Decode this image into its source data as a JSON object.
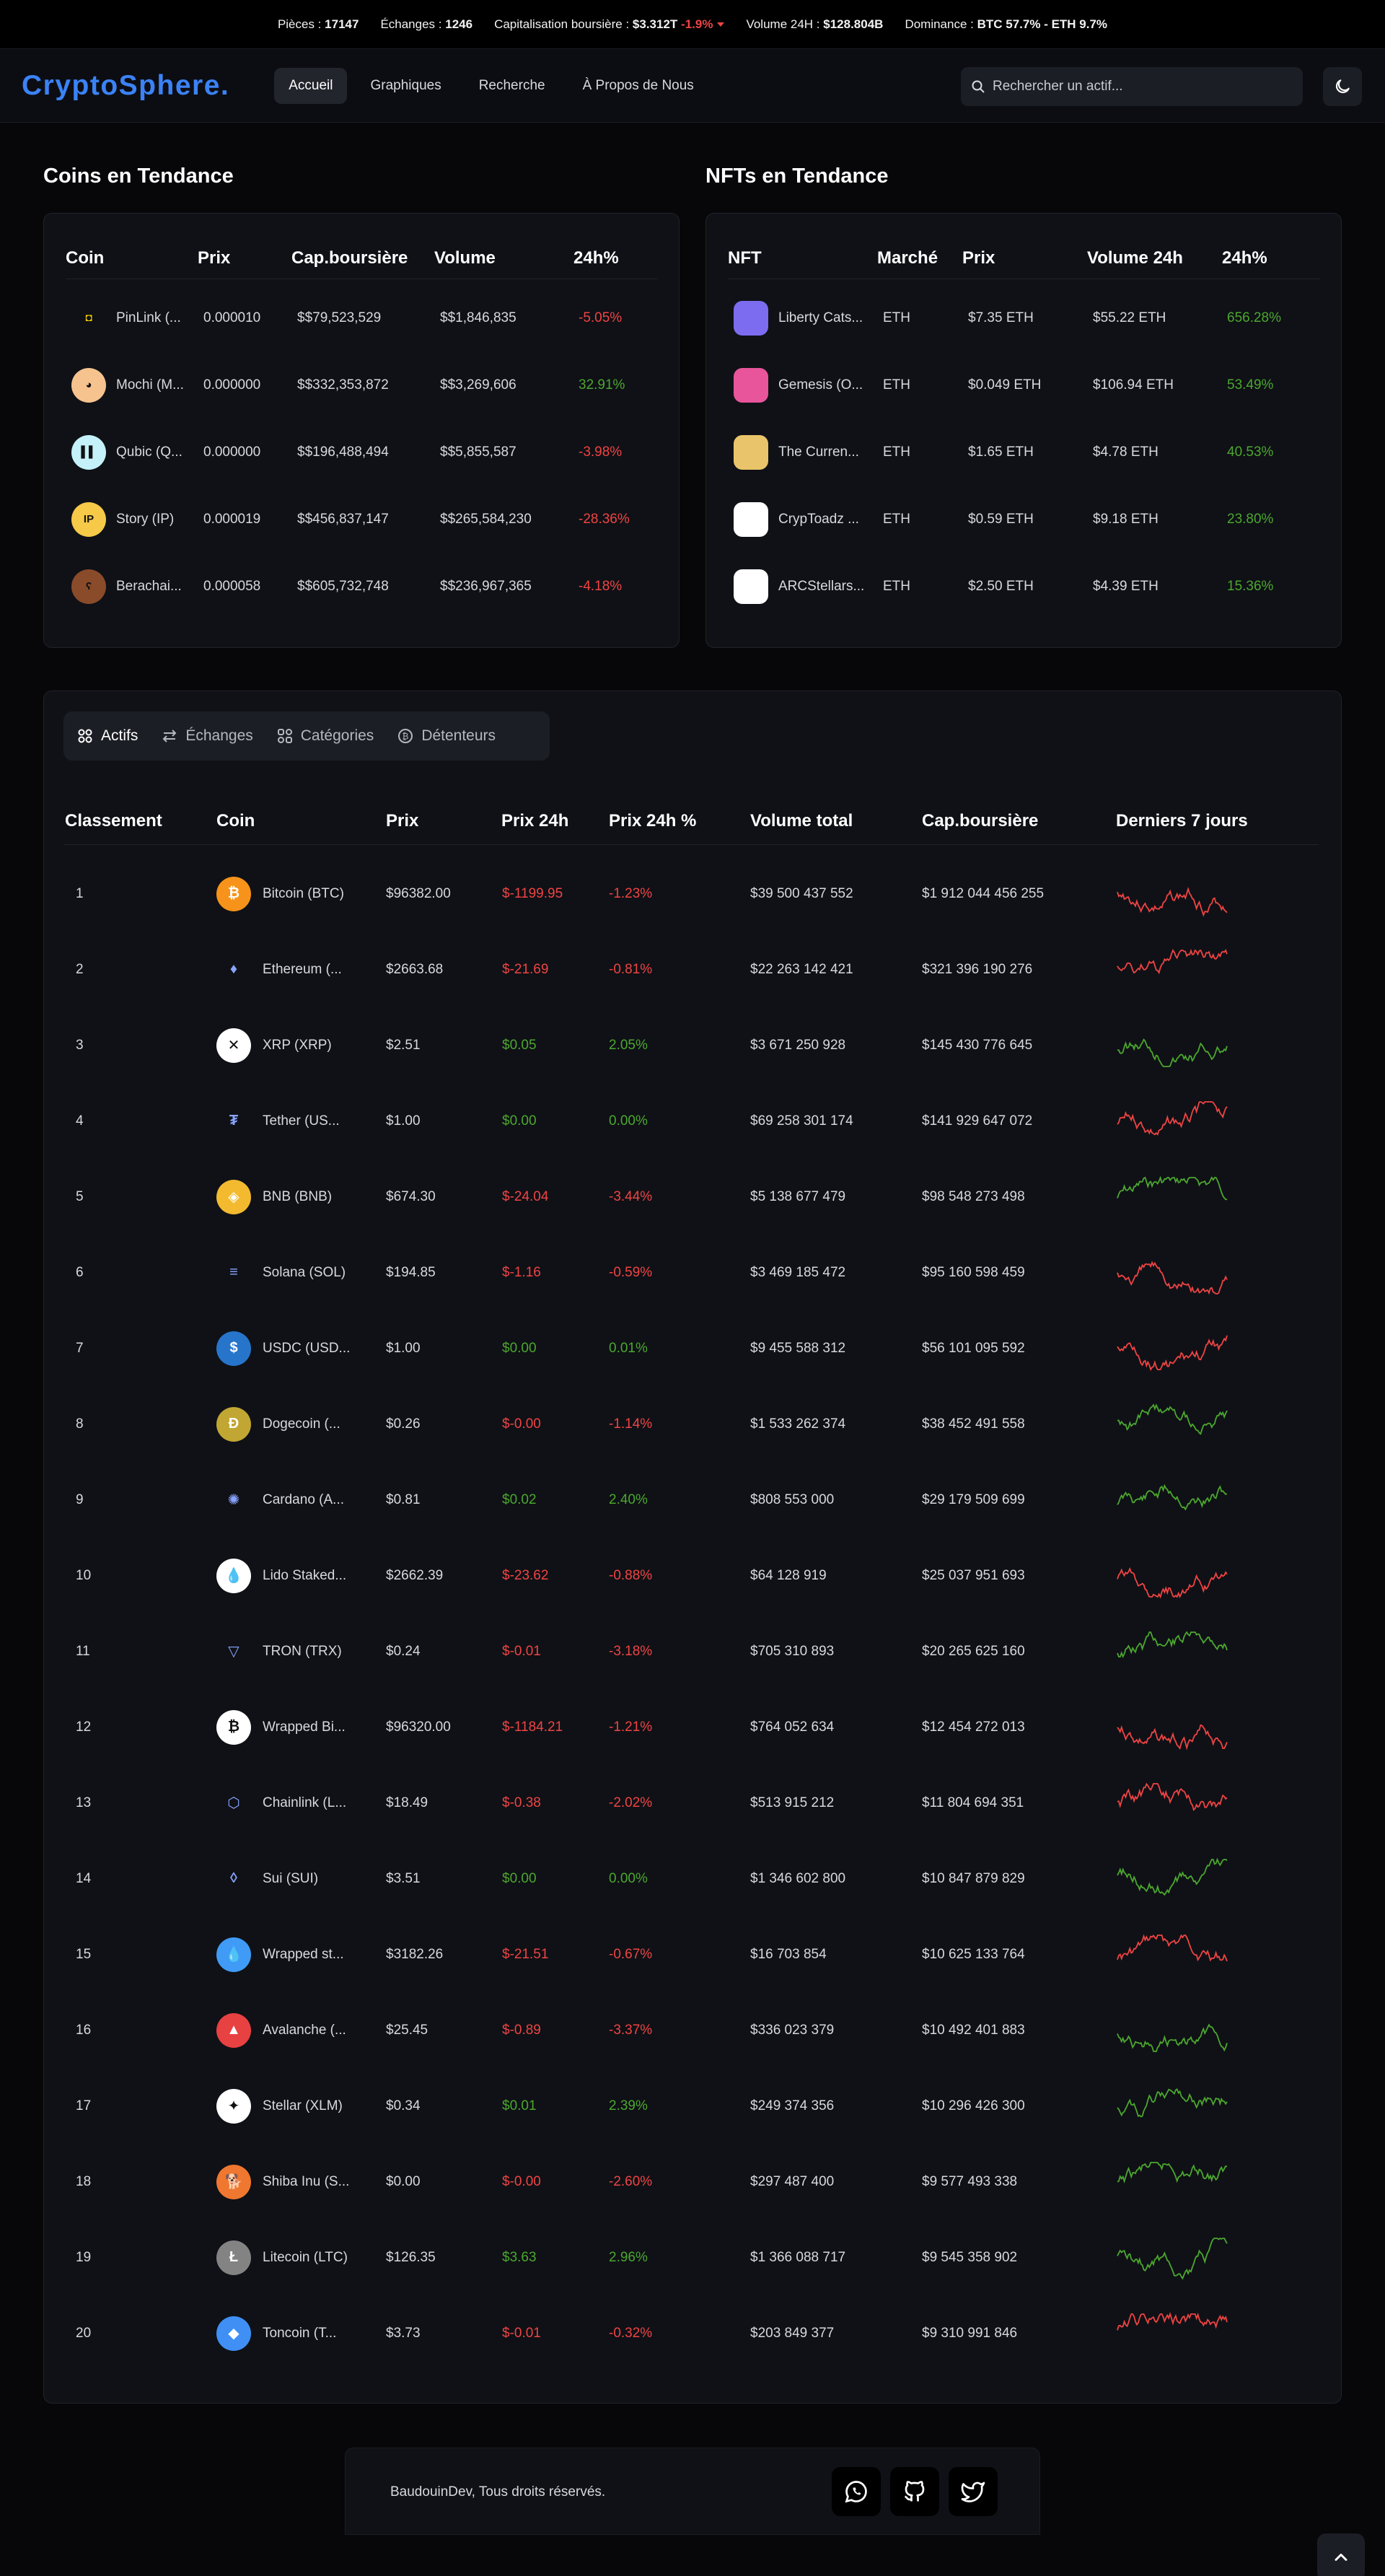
{
  "stats": {
    "coins_label": "Pièces :",
    "coins_value": "17147",
    "exchanges_label": "Échanges :",
    "exchanges_value": "1246",
    "mcap_label": "Capitalisation boursière :",
    "mcap_value": "$3.312T",
    "mcap_change": "-1.9%",
    "volume_label": "Volume 24H :",
    "volume_value": "$128.804B",
    "dominance_label": "Dominance :",
    "dominance_value": "BTC 57.7% - ETH 9.7%"
  },
  "navbar": {
    "logo": "CryptoSphere.",
    "items": [
      "Accueil",
      "Graphiques",
      "Recherche",
      "À Propos de Nous"
    ],
    "search_placeholder": "Rechercher un actif..."
  },
  "trending_coins": {
    "title": "Coins en Tendance",
    "headers": [
      "Coin",
      "Prix",
      "Cap.boursière",
      "Volume",
      "24h%"
    ],
    "rows": [
      {
        "name": "PinLink (...",
        "price": "0.000010",
        "mcap": "$$79,523,529",
        "volume": "$$1,846,835",
        "change": "-5.05%",
        "positive": false,
        "icon": "pinlink-icon",
        "color": "#0f1116",
        "glyph": "◘"
      },
      {
        "name": "Mochi (M...",
        "price": "0.000000",
        "mcap": "$$332,353,872",
        "volume": "$$3,269,606",
        "change": "32.91%",
        "positive": true,
        "icon": "mochi-icon",
        "color": "#f6c38e",
        "glyph": "◕"
      },
      {
        "name": "Qubic (Q...",
        "price": "0.000000",
        "mcap": "$$196,488,494",
        "volume": "$$5,855,587",
        "change": "-3.98%",
        "positive": false,
        "icon": "qubic-icon",
        "color": "#c4f1fa",
        "glyph": "▌▌"
      },
      {
        "name": "Story (IP)",
        "price": "0.000019",
        "mcap": "$$456,837,147",
        "volume": "$$265,584,230",
        "change": "-28.36%",
        "positive": false,
        "icon": "story-icon",
        "color": "#f7c948",
        "glyph": "IP"
      },
      {
        "name": "Berachai...",
        "price": "0.000058",
        "mcap": "$$605,732,748",
        "volume": "$$236,967,365",
        "change": "-4.18%",
        "positive": false,
        "icon": "berachain-icon",
        "color": "#8a4b2a",
        "glyph": "ʕ"
      }
    ]
  },
  "trending_nfts": {
    "title": "NFTs en Tendance",
    "headers": [
      "NFT",
      "Marché",
      "Prix",
      "Volume 24h",
      "24h%"
    ],
    "rows": [
      {
        "name": "Liberty Cats...",
        "market": "ETH",
        "price": "$7.35 ETH",
        "volume": "$55.22 ETH",
        "change": "656.28%",
        "icon": "liberty-cats-icon",
        "color": "#7c6cf0"
      },
      {
        "name": "Gemesis (O...",
        "market": "ETH",
        "price": "$0.049 ETH",
        "volume": "$106.94 ETH",
        "change": "53.49%",
        "icon": "gemesis-icon",
        "color": "#e8559b"
      },
      {
        "name": "The Curren...",
        "market": "ETH",
        "price": "$1.65 ETH",
        "volume": "$4.78 ETH",
        "change": "40.53%",
        "icon": "the-currency-icon",
        "color": "#e9c46a"
      },
      {
        "name": "CrypToadz ...",
        "market": "ETH",
        "price": "$0.59 ETH",
        "volume": "$9.18 ETH",
        "change": "23.80%",
        "icon": "cryptoadz-icon",
        "color": "#ffffff"
      },
      {
        "name": "ARCStellars...",
        "market": "ETH",
        "price": "$2.50 ETH",
        "volume": "$4.39 ETH",
        "change": "15.36%",
        "icon": "arcstellars-icon",
        "color": "#ffffff"
      }
    ]
  },
  "tabs": [
    "Actifs",
    "Échanges",
    "Catégories",
    "Détenteurs"
  ],
  "table": {
    "headers": [
      "Classement",
      "Coin",
      "Prix",
      "Prix 24h",
      "Prix 24h %",
      "Volume total",
      "Cap.boursière",
      "Derniers 7 jours"
    ],
    "rows": [
      {
        "rank": "1",
        "name": "Bitcoin (BTC)",
        "price": "$96382.00",
        "p24": "$-1199.95",
        "pct": "-1.23%",
        "vol": "$39 500 437 552",
        "mcap": "$1 912 044 456 255",
        "positive": false,
        "icon": "bitcoin-icon",
        "color": "#f7931a",
        "glyph": "₿"
      },
      {
        "rank": "2",
        "name": "Ethereum (...",
        "price": "$2663.68",
        "p24": "$-21.69",
        "pct": "-0.81%",
        "vol": "$22 263 142 421",
        "mcap": "$321 396 190 276",
        "positive": false,
        "icon": "ethereum-icon",
        "color": "#0f1116",
        "glyph": "♦"
      },
      {
        "rank": "3",
        "name": "XRP (XRP)",
        "price": "$2.51",
        "p24": "$0.05",
        "pct": "2.05%",
        "vol": "$3 671 250 928",
        "mcap": "$145 430 776 645",
        "positive": true,
        "icon": "xrp-icon",
        "color": "#ffffff",
        "glyph": "✕"
      },
      {
        "rank": "4",
        "name": "Tether (US...",
        "price": "$1.00",
        "p24": "$0.00",
        "pct": "0.00%",
        "vol": "$69 258 301 174",
        "mcap": "$141 929 647 072",
        "positive": false,
        "icon": "tether-icon",
        "color": "#0f1116",
        "glyph": "₮"
      },
      {
        "rank": "5",
        "name": "BNB (BNB)",
        "price": "$674.30",
        "p24": "$-24.04",
        "pct": "-3.44%",
        "vol": "$5 138 677 479",
        "mcap": "$98 548 273 498",
        "positive": true,
        "icon": "bnb-icon",
        "color": "#f3ba2f",
        "glyph": "◈"
      },
      {
        "rank": "6",
        "name": "Solana (SOL)",
        "price": "$194.85",
        "p24": "$-1.16",
        "pct": "-0.59%",
        "vol": "$3 469 185 472",
        "mcap": "$95 160 598 459",
        "positive": false,
        "icon": "solana-icon",
        "color": "#0f1116",
        "glyph": "≡"
      },
      {
        "rank": "7",
        "name": "USDC (USD...",
        "price": "$1.00",
        "p24": "$0.00",
        "pct": "0.01%",
        "vol": "$9 455 588 312",
        "mcap": "$56 101 095 592",
        "positive": false,
        "icon": "usdc-icon",
        "color": "#2775ca",
        "glyph": "$"
      },
      {
        "rank": "8",
        "name": "Dogecoin (...",
        "price": "$0.26",
        "p24": "$-0.00",
        "pct": "-1.14%",
        "vol": "$1 533 262 374",
        "mcap": "$38 452 491 558",
        "positive": true,
        "icon": "dogecoin-icon",
        "color": "#c2a633",
        "glyph": "Ð"
      },
      {
        "rank": "9",
        "name": "Cardano (A...",
        "price": "$0.81",
        "p24": "$0.02",
        "pct": "2.40%",
        "vol": "$808 553 000",
        "mcap": "$29 179 509 699",
        "positive": true,
        "icon": "cardano-icon",
        "color": "#0f1116",
        "glyph": "✺"
      },
      {
        "rank": "10",
        "name": "Lido Staked...",
        "price": "$2662.39",
        "p24": "$-23.62",
        "pct": "-0.88%",
        "vol": "$64 128 919",
        "mcap": "$25 037 951 693",
        "positive": false,
        "icon": "lido-icon",
        "color": "#ffffff",
        "glyph": "💧"
      },
      {
        "rank": "11",
        "name": "TRON (TRX)",
        "price": "$0.24",
        "p24": "$-0.01",
        "pct": "-3.18%",
        "vol": "$705 310 893",
        "mcap": "$20 265 625 160",
        "positive": true,
        "icon": "tron-icon",
        "color": "#0f1116",
        "glyph": "▽"
      },
      {
        "rank": "12",
        "name": "Wrapped Bi...",
        "price": "$96320.00",
        "p24": "$-1184.21",
        "pct": "-1.21%",
        "vol": "$764 052 634",
        "mcap": "$12 454 272 013",
        "positive": false,
        "icon": "wrapped-bitcoin-icon",
        "color": "#ffffff",
        "glyph": "₿"
      },
      {
        "rank": "13",
        "name": "Chainlink (L...",
        "price": "$18.49",
        "p24": "$-0.38",
        "pct": "-2.02%",
        "vol": "$513 915 212",
        "mcap": "$11 804 694 351",
        "positive": false,
        "icon": "chainlink-icon",
        "color": "#0f1116",
        "glyph": "⬡"
      },
      {
        "rank": "14",
        "name": "Sui (SUI)",
        "price": "$3.51",
        "p24": "$0.00",
        "pct": "0.00%",
        "vol": "$1 346 602 800",
        "mcap": "$10 847 879 829",
        "positive": true,
        "icon": "sui-icon",
        "color": "#0f1116",
        "glyph": "◊"
      },
      {
        "rank": "15",
        "name": "Wrapped st...",
        "price": "$3182.26",
        "p24": "$-21.51",
        "pct": "-0.67%",
        "vol": "$16 703 854",
        "mcap": "$10 625 133 764",
        "positive": false,
        "icon": "wrapped-steth-icon",
        "color": "#3f9bf5",
        "glyph": "💧"
      },
      {
        "rank": "16",
        "name": "Avalanche (...",
        "price": "$25.45",
        "p24": "$-0.89",
        "pct": "-3.37%",
        "vol": "$336 023 379",
        "mcap": "$10 492 401 883",
        "positive": true,
        "icon": "avalanche-icon",
        "color": "#e84142",
        "glyph": "▲"
      },
      {
        "rank": "17",
        "name": "Stellar (XLM)",
        "price": "$0.34",
        "p24": "$0.01",
        "pct": "2.39%",
        "vol": "$249 374 356",
        "mcap": "$10 296 426 300",
        "positive": true,
        "icon": "stellar-icon",
        "color": "#ffffff",
        "glyph": "✦"
      },
      {
        "rank": "18",
        "name": "Shiba Inu (S...",
        "price": "$0.00",
        "p24": "$-0.00",
        "pct": "-2.60%",
        "vol": "$297 487 400",
        "mcap": "$9 577 493 338",
        "positive": true,
        "icon": "shiba-inu-icon",
        "color": "#f0772f",
        "glyph": "🐕"
      },
      {
        "rank": "19",
        "name": "Litecoin (LTC)",
        "price": "$126.35",
        "p24": "$3.63",
        "pct": "2.96%",
        "vol": "$1 366 088 717",
        "mcap": "$9 545 358 902",
        "positive": true,
        "icon": "litecoin-icon",
        "color": "#838383",
        "glyph": "Ł"
      },
      {
        "rank": "20",
        "name": "Toncoin (T...",
        "price": "$3.73",
        "p24": "$-0.01",
        "pct": "-0.32%",
        "vol": "$203 849 377",
        "mcap": "$9 310 991 846",
        "positive": false,
        "icon": "toncoin-icon",
        "color": "#3f8ff5",
        "glyph": "◆"
      }
    ]
  },
  "footer": {
    "copyright": "BaudouinDev, Tous droits réservés."
  },
  "colors": {
    "accent": "#3b82f6",
    "positive": "#4ca72f",
    "negative": "#ef4444",
    "bg": "#070709",
    "card": "#0f1116"
  }
}
